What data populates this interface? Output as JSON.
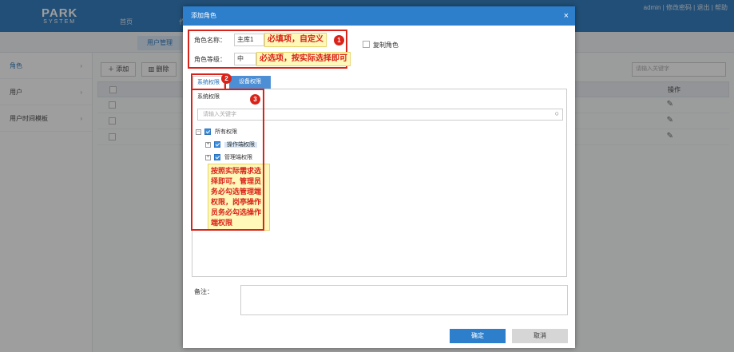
{
  "app": {
    "logo_big": "PARK",
    "logo_small": "SYSTEM",
    "nav": [
      "首页",
      "作"
    ],
    "userbar": "admin | 修改密码 | 退出 | 帮助"
  },
  "tabbar": {
    "active_tab": "用户管理"
  },
  "sidebar": {
    "items": [
      {
        "label": "角色"
      },
      {
        "label": "用户"
      },
      {
        "label": "用户时间模板"
      }
    ]
  },
  "content": {
    "add_label": "添加",
    "delete_label": "删除",
    "search_placeholder": "请输入关键字",
    "op_header": "操作"
  },
  "modal": {
    "title": "添加角色",
    "close": "×",
    "role_name_label": "角色名称：",
    "role_name_value": "主库1",
    "role_name_note": "必填项，自定义",
    "role_level_label": "角色等级：",
    "role_level_value": "中",
    "role_level_note": "必选项，按实际选择即可",
    "copy_role_label": "复制角色",
    "tabs": [
      "系统权限",
      "设备权限"
    ],
    "panel_title": "系统权限",
    "tree_search_placeholder": "请输入关键字",
    "tree": {
      "root": "所有权限",
      "child1": "操作端权限",
      "child2": "管理端权限"
    },
    "tree_note": "按照实际需求选择即可。管理员务必勾选管理端权限，岗亭操作员务必勾选操作端权限",
    "badges": [
      "1",
      "2",
      "3"
    ],
    "remark_label": "备注：",
    "ok_label": "确定",
    "cancel_label": "取消"
  },
  "colors": {
    "primary": "#2d7ecb",
    "annotation_red": "#d9231a",
    "annotation_bg": "#fff8b8"
  }
}
